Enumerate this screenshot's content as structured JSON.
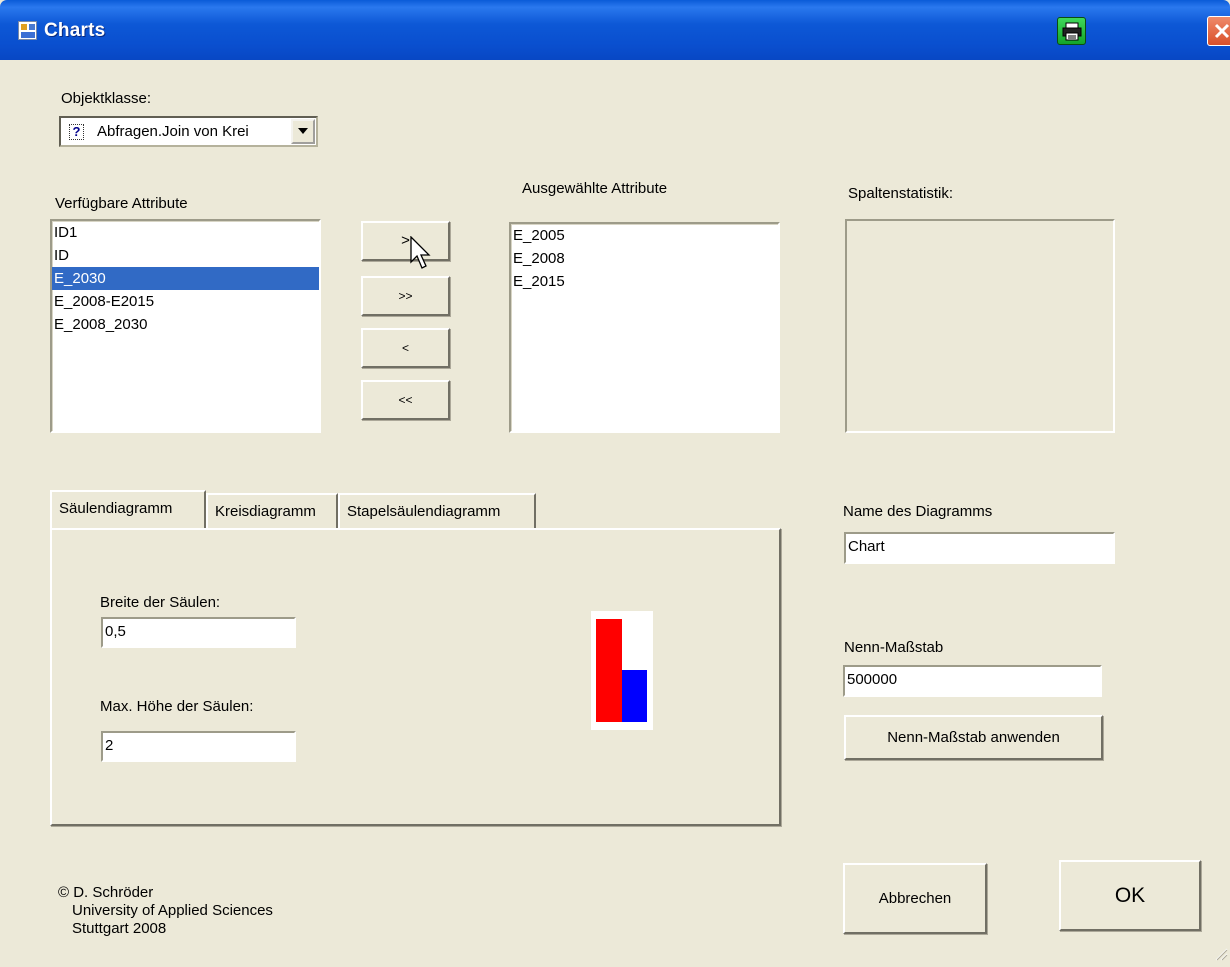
{
  "window": {
    "title": "Charts"
  },
  "objektklasse": {
    "label": "Objektklasse:",
    "selected": "Abfragen.Join von  Krei"
  },
  "available": {
    "label": "Verfügbare Attribute",
    "items": [
      "ID1",
      "ID",
      "E_2030",
      "E_2008-E2015",
      "E_2008_2030"
    ],
    "selected_index": 2
  },
  "selected_attrs": {
    "label": "Ausgewählte Attribute",
    "items": [
      "E_2005",
      "E_2008",
      "E_2015"
    ]
  },
  "transfer_buttons": {
    "add": ">",
    "add_all": ">>",
    "remove": "<",
    "remove_all": "<<"
  },
  "stats": {
    "label": "Spaltenstatistik:"
  },
  "tabs": {
    "items": [
      "Säulendiagramm",
      "Kreisdiagramm",
      "Stapelsäulendiagramm"
    ],
    "active_index": 0
  },
  "bar_settings": {
    "width_label": "Breite der Säulen:",
    "width_value": "0,5",
    "max_height_label": "Max. Höhe der Säulen:",
    "max_height_value": "2"
  },
  "chart_preview": {
    "bar_values": [
      2,
      1
    ],
    "colors": [
      "#ff0000",
      "#0000ff"
    ]
  },
  "diagram_name": {
    "label": "Name des Diagramms",
    "value": "Chart"
  },
  "scale": {
    "label": "Nenn-Maßstab",
    "value": "500000",
    "apply_button": "Nenn-Maßstab anwenden"
  },
  "credits": {
    "line1": "© D. Schröder",
    "line2": "University of Applied Sciences",
    "line3": "Stuttgart 2008"
  },
  "actions": {
    "cancel": "Abbrechen",
    "ok": "OK"
  },
  "colors": {
    "titlebar": "#0a4fcf",
    "selection": "#316ac5",
    "dialog_bg": "#ece9d8"
  }
}
